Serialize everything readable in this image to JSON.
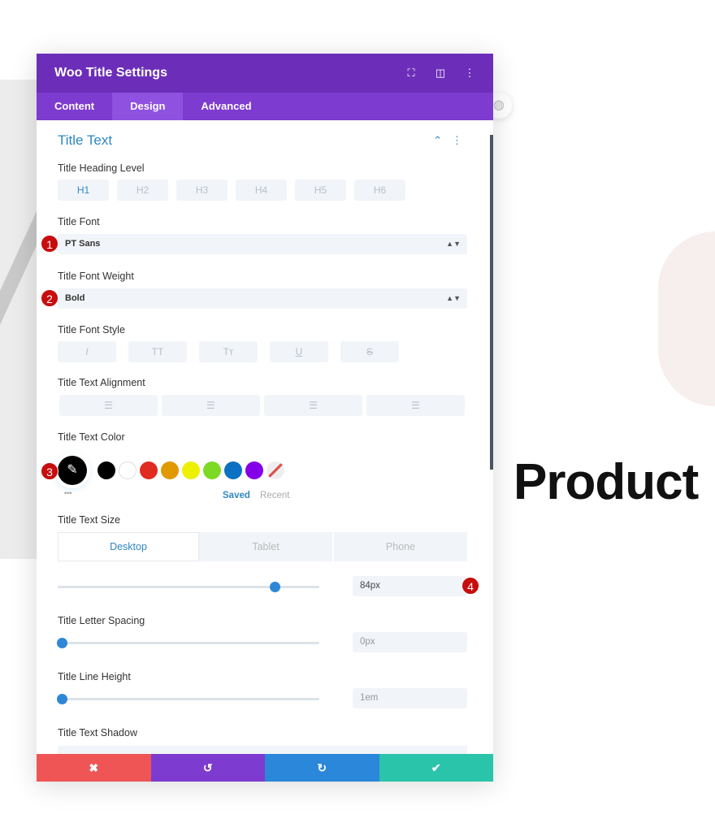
{
  "canvas": {
    "product_text": "Product"
  },
  "header": {
    "title": "Woo Title Settings",
    "icons": [
      "fullscreen-icon",
      "split-view-icon",
      "more-icon"
    ]
  },
  "tabs": [
    {
      "label": "Content"
    },
    {
      "label": "Design",
      "active": true
    },
    {
      "label": "Advanced"
    }
  ],
  "section": {
    "title": "Title Text"
  },
  "heading_level": {
    "label": "Title Heading Level",
    "options": [
      "H1",
      "H2",
      "H3",
      "H4",
      "H5",
      "H6"
    ],
    "selected": "H1"
  },
  "font": {
    "label": "Title Font",
    "value": "PT Sans",
    "badge": "1"
  },
  "weight": {
    "label": "Title Font Weight",
    "value": "Bold",
    "badge": "2"
  },
  "style": {
    "label": "Title Font Style",
    "options": [
      "I",
      "TT",
      "Tт",
      "U",
      "S"
    ]
  },
  "alignment": {
    "label": "Title Text Alignment"
  },
  "color": {
    "label": "Title Text Color",
    "badge": "3",
    "selected": "#000000",
    "swatches": [
      "#000000",
      "#ffffff",
      "#e02b20",
      "#e09900",
      "#edf000",
      "#7cda24",
      "#0c71c3",
      "#8300e9"
    ],
    "saved": "Saved",
    "recent": "Recent",
    "more": "•••"
  },
  "size": {
    "label": "Title Text Size",
    "devices": [
      "Desktop",
      "Tablet",
      "Phone"
    ],
    "active_device": "Desktop",
    "value": "84px",
    "slider_fraction": 0.83,
    "badge": "4"
  },
  "letter_spacing": {
    "label": "Title Letter Spacing",
    "value": "0px",
    "slider_fraction": 0
  },
  "line_height": {
    "label": "Title Line Height",
    "value": "1em",
    "slider_fraction": 0
  },
  "shadow": {
    "label": "Title Text Shadow"
  },
  "footer": {
    "colors": [
      "#ef5555",
      "#7e3bd0",
      "#2b87da",
      "#29c4a9"
    ]
  }
}
